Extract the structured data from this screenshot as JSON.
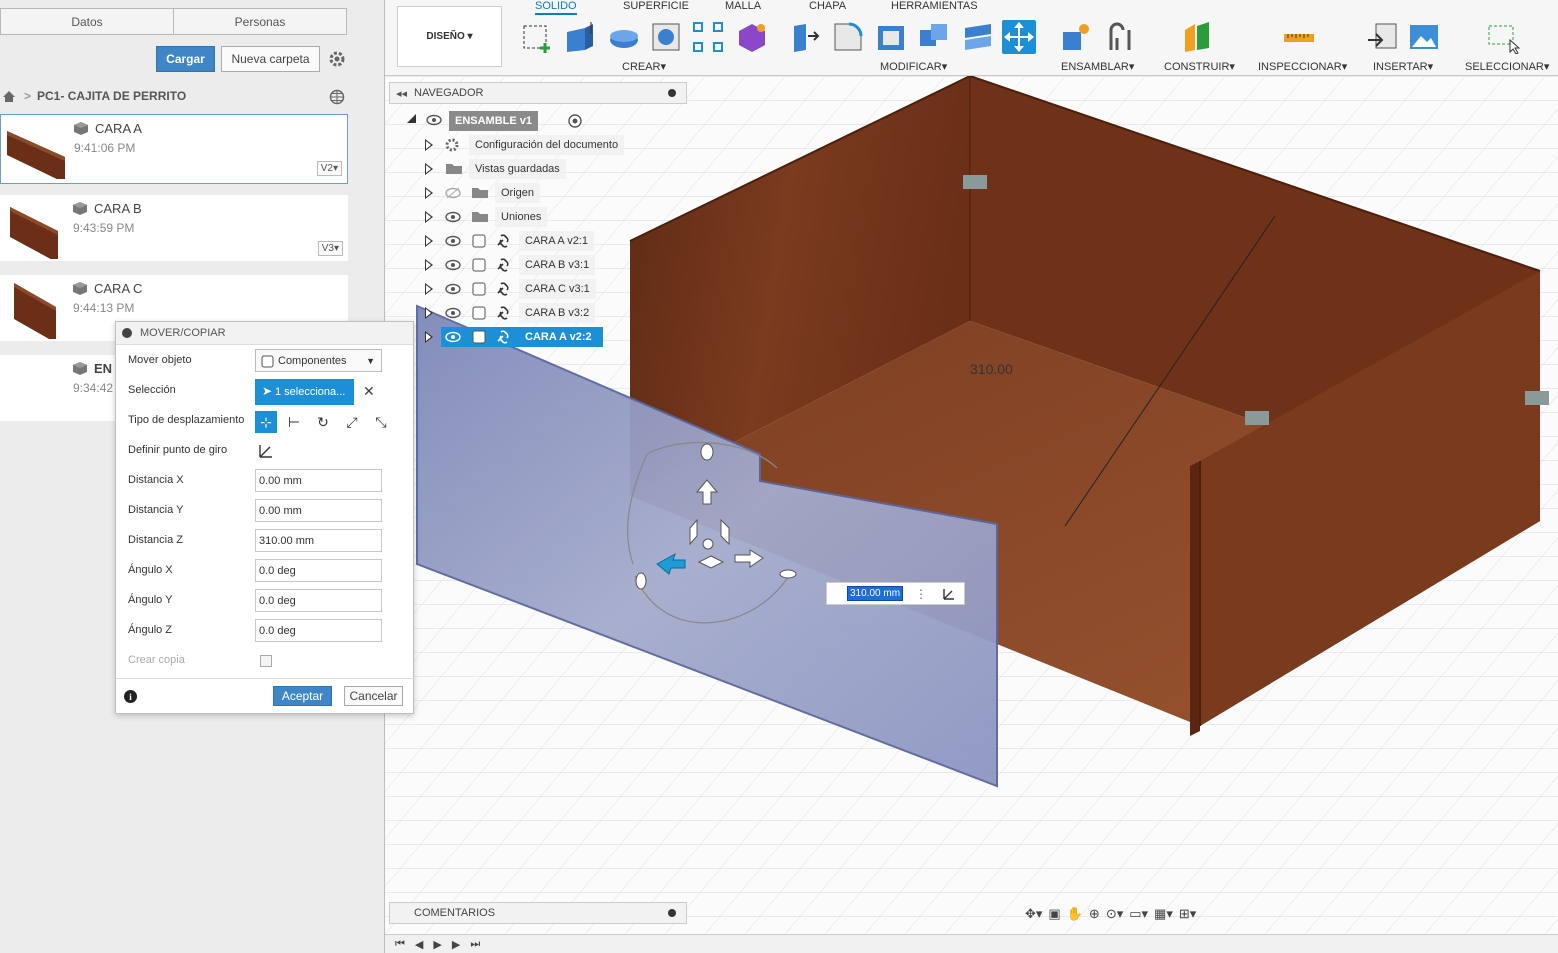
{
  "left": {
    "tabs": [
      "Datos",
      "Personas"
    ],
    "upload_label": "Cargar",
    "new_folder_label": "Nueva carpeta",
    "project": "PC1- CAJITA DE PERRITO",
    "files": [
      {
        "name": "CARA A",
        "time": "9:41:06 PM",
        "version": "V2"
      },
      {
        "name": "CARA B",
        "time": "9:43:59 PM",
        "version": "V3"
      },
      {
        "name": "CARA C",
        "time": "9:44:13 PM",
        "version": ""
      },
      {
        "name": "EN",
        "time": "9:34:42",
        "version": ""
      }
    ]
  },
  "dialog": {
    "title": "MOVER/COPIAR",
    "rows": {
      "move_object": {
        "label": "Mover objeto",
        "value": "Componentes"
      },
      "selection": {
        "label": "Selección",
        "value": "1 selecciona..."
      },
      "move_type": {
        "label": "Tipo de desplazamiento"
      },
      "pivot": {
        "label": "Definir punto de giro"
      },
      "dist_x": {
        "label": "Distancia X",
        "value": "0.00 mm"
      },
      "dist_y": {
        "label": "Distancia Y",
        "value": "0.00 mm"
      },
      "dist_z": {
        "label": "Distancia Z",
        "value": "310.00 mm"
      },
      "angle_x": {
        "label": "Ángulo X",
        "value": "0.0 deg"
      },
      "angle_y": {
        "label": "Ángulo Y",
        "value": "0.0 deg"
      },
      "angle_z": {
        "label": "Ángulo Z",
        "value": "0.0 deg"
      },
      "copy": {
        "label": "Crear copia"
      }
    },
    "ok_label": "Aceptar",
    "cancel_label": "Cancelar"
  },
  "toolbar": {
    "workspace": "DISEÑO",
    "tabs": [
      "SOLIDO",
      "SUPERFICIE",
      "MALLA",
      "CHAPA",
      "HERRAMIENTAS"
    ],
    "groups": [
      "CREAR",
      "MODIFICAR",
      "ENSAMBLAR",
      "CONSTRUIR",
      "INSPECCIONAR",
      "INSERTAR",
      "SELECCIONAR"
    ]
  },
  "browser": {
    "title": "NAVEGADOR",
    "root": "ENSAMBLE v1",
    "items": [
      "Configuración del documento",
      "Vistas guardadas",
      "Origen",
      "Uniones",
      "CARA A v2:1",
      "CARA B v3:1",
      "CARA C v3:1",
      "CARA B v3:2",
      "CARA A v2:2"
    ]
  },
  "viewport": {
    "dimension_label": "310.00",
    "inline_value": "310.00 mm"
  },
  "comments_title": "COMENTARIOS",
  "colors": {
    "accent": "#1d8fd6",
    "wood": "#7a3b1f",
    "panel_blue": "#8c96c2"
  }
}
